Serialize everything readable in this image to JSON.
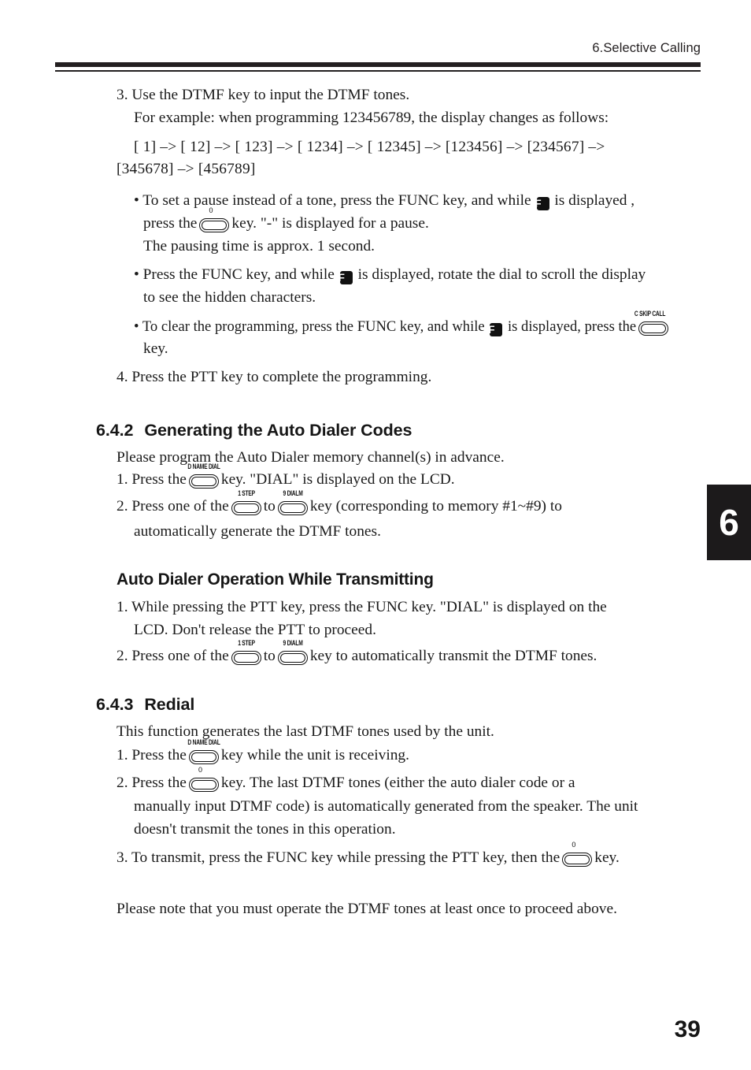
{
  "header": {
    "chapter_title": "6.Selective Calling"
  },
  "chapter_tab": {
    "number": "6"
  },
  "page_number": "39",
  "steps_top": {
    "step3_line1": "3. Use the DTMF key to input the DTMF tones.",
    "step3_line2": "For example: when programming 123456789, the display changes as follows:",
    "sequence_line1": "[        1] –> [       12] –> [      123] –> [   1234] –> [  12345] –> [123456] –> [234567] –>",
    "sequence_line2": "[345678] –> [456789]",
    "step4": "4. Press the PTT key to complete the programming."
  },
  "bullets": [
    {
      "part1": "• To set a pause instead of a tone, press the FUNC key, and while",
      "badge": "F",
      "part2": "is displayed ,",
      "line2_pre": "press the",
      "key_label": "0",
      "line2_post": "key.  \"-\" is displayed for a pause.",
      "line3": "The pausing time is approx. 1 second."
    },
    {
      "part1": "• Press the FUNC key, and while",
      "badge": "F",
      "part2": "is displayed, rotate the dial to scroll the display",
      "line2": "to see the hidden characters."
    },
    {
      "part1": "• To clear the programming, press the FUNC key, and while",
      "badge": "F",
      "part2": "is displayed, press the",
      "key_label": "C SKIP CALL",
      "line2": "key."
    }
  ],
  "section_642": {
    "number": "6.4.2",
    "title": "Generating the Auto Dialer Codes",
    "intro": "Please program the Auto Dialer memory channel(s) in advance.",
    "step1_pre": "1. Press the",
    "step1_key": "D NAME DIAL",
    "step1_post": "key.  \"DIAL\" is displayed on the LCD.",
    "step2_pre": "2. Press  one  of  the",
    "step2_key_a": "1 STEP",
    "step2_mid": "to",
    "step2_key_b": "9 DIALM",
    "step2_post": "key  (corresponding  to  memory  #1~#9)  to",
    "step2_line2": "automatically generate the DTMF tones."
  },
  "subsection_transmit": {
    "title": "Auto Dialer Operation While Transmitting",
    "step1_line1": "1. While  pressing  the  PTT  key,  press  the  FUNC  key.   \"DIAL\"  is  displayed  on  the",
    "step1_line2": "LCD.  Don't release the PTT to proceed.",
    "step2_pre": "2. Press one of the",
    "step2_key_a": "1 STEP",
    "step2_mid": "to",
    "step2_key_b": "9 DIALM",
    "step2_post": "key to automatically transmit the DTMF tones."
  },
  "section_643": {
    "number": "6.4.3",
    "title": "Redial",
    "intro": "This function generates the last DTMF tones used by the unit.",
    "step1_pre": "1. Press the",
    "step1_key": "D NAME DIAL",
    "step1_post": "key while the unit is receiving.",
    "step2_pre": "2. Press the",
    "step2_key": "0",
    "step2_post": "key.   The  last  DTMF  tones  (either  the  auto  dialer  code  or  a",
    "step2_line2": "manually input DTMF code) is automatically generated from the speaker.  The unit",
    "step2_line3": "doesn't transmit the tones in this operation.",
    "step3_pre": "3. To transmit, press the FUNC key while pressing the PTT key, then the",
    "step3_key": "0",
    "step3_post": "key."
  },
  "footer_note": "Please note that you must operate the DTMF tones at least once to proceed above."
}
